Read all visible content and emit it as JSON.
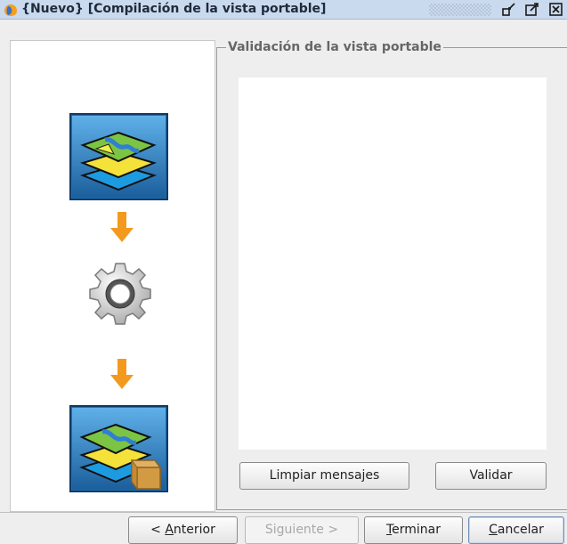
{
  "window": {
    "title": "{Nuevo} [Compilación de la vista portable]",
    "icon": "app-fruit-icon",
    "controls": [
      "minimize-icon",
      "maximize-icon",
      "close-icon"
    ]
  },
  "panel": {
    "legend": "Validación de la vista portable",
    "buttons": {
      "clear": "Limpiar mensajes",
      "validate": "Validar"
    }
  },
  "steps": {
    "icons": [
      "map-layers-icon",
      "arrow-down-icon",
      "gear-icon",
      "arrow-down-icon",
      "map-package-icon"
    ]
  },
  "wizard": {
    "prev": {
      "pre": "< ",
      "mnemonic": "A",
      "rest": "nterior"
    },
    "next": {
      "label": "Siguiente >"
    },
    "finish": {
      "mnemonic": "T",
      "rest": "erminar"
    },
    "cancel": {
      "mnemonic": "C",
      "rest": "ancelar"
    }
  },
  "colors": {
    "accent_orange": "#f39a1e",
    "icon_frame": "#0f3a66",
    "title_bar": "#c9d9ee"
  }
}
